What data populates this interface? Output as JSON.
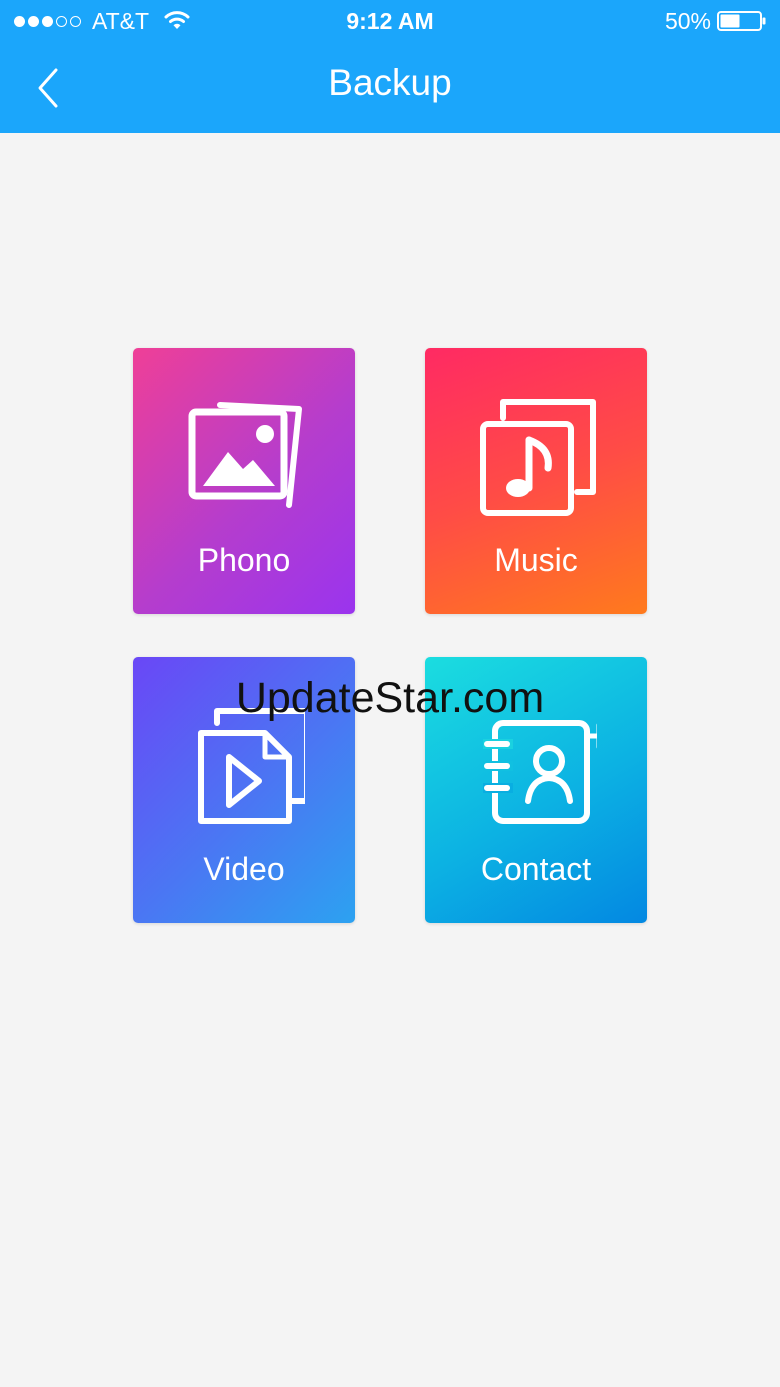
{
  "status_bar": {
    "signal_dots": [
      true,
      true,
      true,
      false,
      false
    ],
    "carrier": "AT&T",
    "time": "9:12 AM",
    "battery_percent": "50%",
    "battery_level": 0.5,
    "icons": [
      "signal-icon",
      "wifi-icon",
      "battery-icon"
    ]
  },
  "nav": {
    "title": "Backup",
    "back_icon": "chevron-left-icon"
  },
  "tiles": [
    {
      "label": "Phono",
      "icon": "photo-icon",
      "colors": [
        "#ef3f97",
        "#9a34ee"
      ]
    },
    {
      "label": "Music",
      "icon": "music-icon",
      "colors": [
        "#ff2a63",
        "#ff7a1d"
      ]
    },
    {
      "label": "Video",
      "icon": "video-icon",
      "colors": [
        "#6a47f6",
        "#2ca2f1"
      ]
    },
    {
      "label": "Contact",
      "icon": "add-contact-icon",
      "colors": [
        "#1bdde0",
        "#0388e2"
      ]
    }
  ],
  "watermark": "UpdateStar.com",
  "colors": {
    "header": "#1ba6fb",
    "background": "#f4f4f4"
  }
}
